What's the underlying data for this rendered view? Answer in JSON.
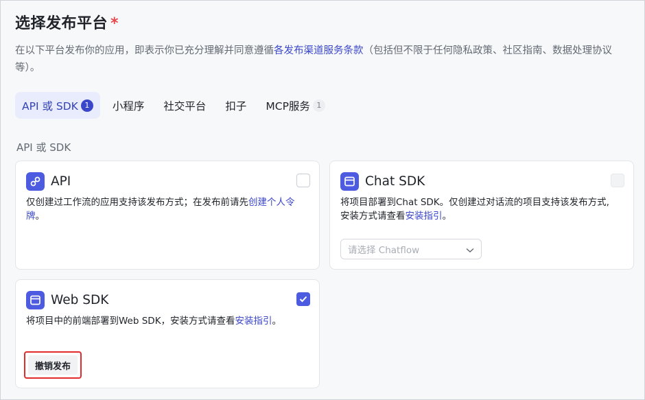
{
  "header": {
    "title": "选择发布平台",
    "required_mark": "*",
    "desc_prefix": "在以下平台发布你的应用，即表示你已充分理解并同意遵循",
    "desc_link": "各发布渠道服务条款",
    "desc_suffix": "（包括但不限于任何隐私政策、社区指南、数据处理协议等）。"
  },
  "tabs": [
    {
      "label": "API 或 SDK",
      "badge": "1",
      "active": true
    },
    {
      "label": "小程序"
    },
    {
      "label": "社交平台"
    },
    {
      "label": "扣子"
    },
    {
      "label": "MCP服务",
      "badge": "1"
    }
  ],
  "section_label": "API 或 SDK",
  "cards": {
    "api": {
      "title": "API",
      "icon": "link-icon",
      "desc_prefix": "仅创建过工作流的应用支持该发布方式；在发布前请先",
      "desc_link": "创建个人令牌",
      "desc_suffix": "。",
      "checked": false
    },
    "chat_sdk": {
      "title": "Chat SDK",
      "icon": "browser-window-icon",
      "desc_prefix": "将项目部署到Chat SDK。仅创建过对话流的项目支持该发布方式,安装方式请查看",
      "desc_link": "安装指引",
      "desc_suffix": "。",
      "select_placeholder": "请选择 Chatflow",
      "checked": false,
      "disabled": true
    },
    "web_sdk": {
      "title": "Web SDK",
      "icon": "browser-window-icon",
      "desc_prefix": "将项目中的前端部署到Web SDK，安装方式请查看",
      "desc_link": "安装指引",
      "desc_suffix": "。",
      "button_label": "撤销发布",
      "checked": true
    }
  },
  "colors": {
    "accent": "#4c5be0",
    "link": "#3b47c9",
    "highlight_border": "#e02b2b"
  }
}
